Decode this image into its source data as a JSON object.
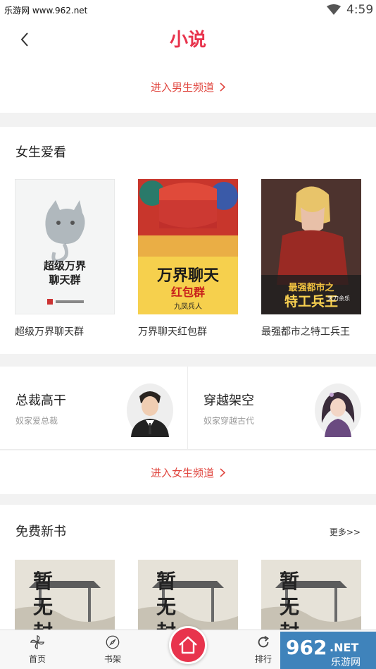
{
  "status_bar": {
    "watermark": "乐游网 www.962.net",
    "time": "4:59"
  },
  "header": {
    "title": "小说"
  },
  "boy_channel": {
    "label": "进入男生频道"
  },
  "girls_section": {
    "title": "女生爱看",
    "books": [
      {
        "title": "超级万界聊天群",
        "cover_title": "超级万界聊天群"
      },
      {
        "title": "万界聊天红包群",
        "cover_title": "万界聊天红包群",
        "cover_author": "九凤兵人"
      },
      {
        "title": "最强都市之特工兵王",
        "cover_title": "最强都市之特工兵王",
        "cover_author": "天刀余乐"
      }
    ]
  },
  "categories": [
    {
      "title": "总裁高干",
      "subtitle": "奴家爱总裁"
    },
    {
      "title": "穿越架空",
      "subtitle": "奴家穿越古代"
    }
  ],
  "girl_channel": {
    "label": "进入女生频道"
  },
  "free_section": {
    "title": "免费新书",
    "more": "更多>>",
    "book_cover_text": "暂无封面"
  },
  "tab_bar": {
    "items": [
      {
        "label": "首页",
        "icon": "pinwheel-icon"
      },
      {
        "label": "书架",
        "icon": "compass-icon"
      },
      {
        "label": "排行",
        "icon": "refresh-icon"
      }
    ],
    "center_icon": "home-icon"
  },
  "corner_logo": {
    "text": "962",
    "subtext": "乐游网"
  },
  "colors": {
    "accent": "#e8344d",
    "link": "#e0453e"
  }
}
